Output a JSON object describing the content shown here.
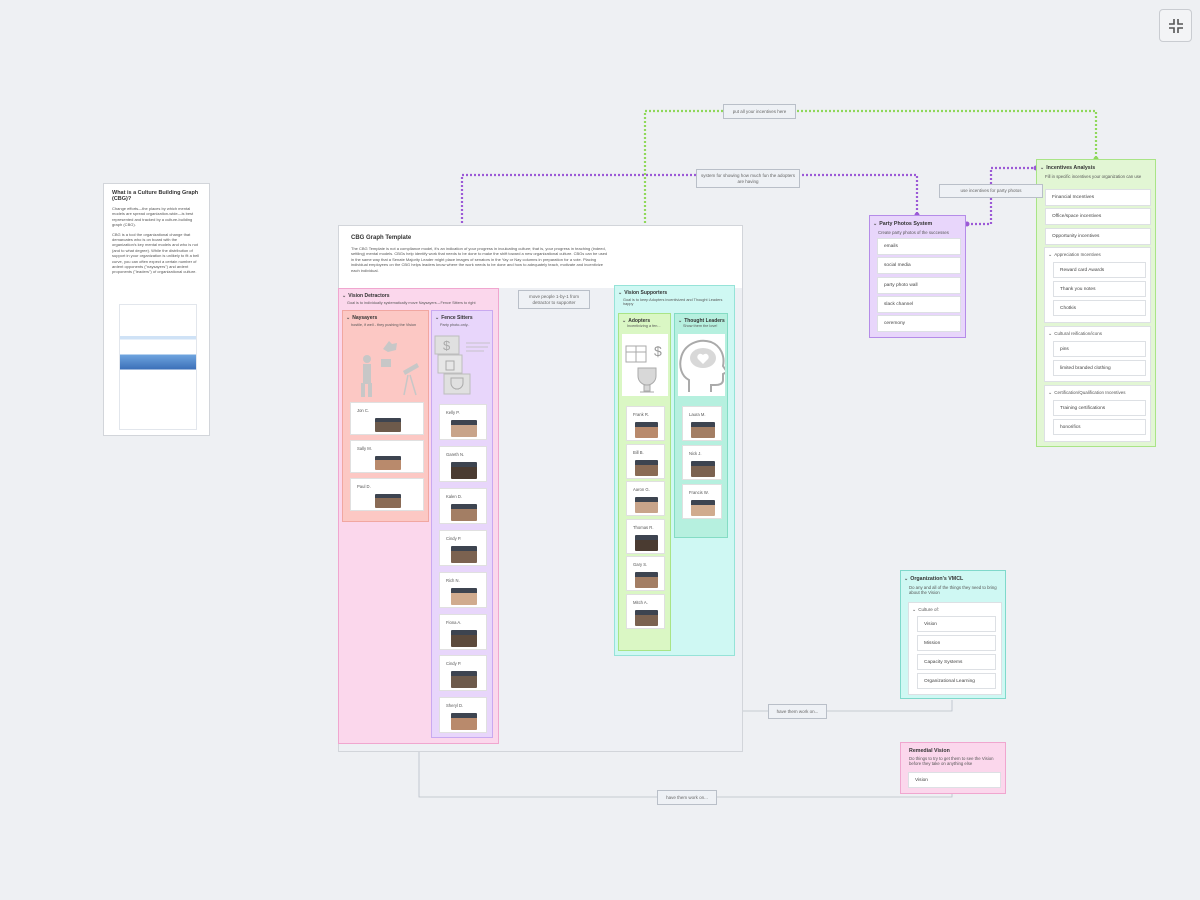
{
  "toolbar": {
    "collapse_icon": "collapse-icon"
  },
  "culture_card": {
    "title": "What is a Culture Building Graph (CBG)?",
    "para1": "Change efforts—the places by which mental models are spread organization-wide—is best represented and tracked by a culture-building graph (CBG).",
    "para2": "CBG is a tool the organizational change that demarcates who is on board with the organization's key mental models and who is not (and to what degree). While the distribution of support in your organization is unlikely to fit a bell curve, you can often expect a certain number of ardent opponents (\"naysayers\") and ardent proponents (\"leaders\") of organizational culture."
  },
  "cbg": {
    "title": "CBG Graph Template",
    "description": "The CBG Template is not a compliance model, it's an indication of your progress in inculcating culture; that is, your progress in teaching (indeed, settling) mental models. CBGs help identify work that needs to be done to make the shift toward a new organizational culture. CBGs can be used in the same way that a Senate Majority Leader might place images of senators in the Yay or Nay columns in preparation for a vote. Placing individual employees on the CBG helps leaders know where the work needs to be done and how to adequately teach, motivate and incentivize each individual."
  },
  "detractors": {
    "title": "Vision Detractors",
    "desc": "Goal is to individually systematically move Naysayers→Fence Sitters to right",
    "naysayers": {
      "title": "Naysayers",
      "desc": "hostile, if well - they pushing the Vision",
      "people": [
        "Jon C.",
        "Sally M.",
        "Paul D."
      ]
    },
    "fence": {
      "title": "Fence Sitters",
      "desc": "Party photo-only..",
      "people": [
        "Kelly P.",
        "Gareth N.",
        "Kalen D.",
        "Cindy P.",
        "Rich N.",
        "Fiona A.",
        "Cindy P.",
        "Sheryl D."
      ]
    }
  },
  "supporters": {
    "title": "Vision Supporters",
    "desc": "Goal is to keep Adopters incentivized and Thought Leaders happy",
    "adopters": {
      "title": "Adopters",
      "desc": "Incentivizing a fen...",
      "people": [
        "Frank R.",
        "Bill B.",
        "Aaron G.",
        "Thomas R.",
        "Gary S.",
        "Mitch A."
      ]
    },
    "thought": {
      "title": "Thought Leaders",
      "desc": "Show them the love!",
      "people": [
        "Laura M.",
        "Nick J.",
        "Francis W."
      ]
    }
  },
  "party": {
    "title": "Party Photos System",
    "desc": "Create party photos of the successes",
    "items": [
      "emails",
      "social media",
      "party photo wall",
      "slack channel",
      "ceremony"
    ]
  },
  "incentives": {
    "title": "Incentives Analysis",
    "desc": "Fill in specific incentives your organization can use",
    "items": [
      "Financial Incentives",
      "Office/space incentives",
      "Opportunity incentives"
    ],
    "groups": [
      {
        "title": "Appreciation Incentives",
        "items": [
          "Reward card Awards",
          "Thank you notes",
          "Chotkis"
        ]
      },
      {
        "title": "Cultural reification/icons",
        "items": [
          "pins",
          "limited branded clothing"
        ]
      },
      {
        "title": "Certification/Qualification Incentives",
        "items": [
          "Training certifications",
          "honorifics"
        ]
      }
    ]
  },
  "vmcl": {
    "title": "Organization's VMCL",
    "desc": "Do any and all of the things they need to bring about the Vision",
    "group": "Culture of:",
    "items": [
      "Vision",
      "Mission",
      "Capacity Systems",
      "Organizational Learning"
    ]
  },
  "remedial": {
    "title": "Remedial Vision",
    "desc": "Do things to try to get them to see the Vision before they take on anything else",
    "items": [
      "Vision"
    ]
  },
  "connectors": {
    "put_incentives": "put all your incentives here",
    "system_photos": "system for showing how much fun the adopters are having",
    "use_incentives": "use incentives for party photos",
    "move_people": "move people 1-by-1 from detractor to supporter",
    "have_them_1": "have them work on...",
    "have_them_2": "have them work on..."
  },
  "colors": {
    "purple_line": "#9b59d6",
    "green_line": "#8fd85a"
  }
}
